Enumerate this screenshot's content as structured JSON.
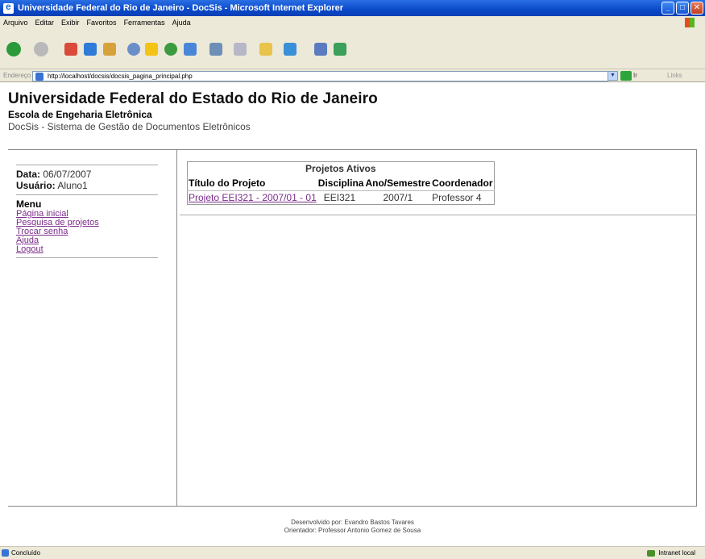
{
  "window": {
    "title": "Universidade Federal do Rio de Janeiro - DocSis - Microsoft Internet Explorer",
    "menu": [
      "Arquivo",
      "Editar",
      "Exibir",
      "Favoritos",
      "Ferramentas",
      "Ajuda"
    ],
    "address_label": "Endereço",
    "url": "http://localhost/docsis/docsis_pagina_principal.php",
    "go_label": "Ir",
    "links_label": "Links",
    "status": "Concluído",
    "zone": "Intranet local"
  },
  "header": {
    "university": "Universidade Federal do Estado do Rio de Janeiro",
    "school": "Escola de Engeharia Eletrônica",
    "system": "DocSis - Sistema de Gestão de Documentos Eletrônicos"
  },
  "sidebar": {
    "date_label": "Data:",
    "date_value": "06/07/2007",
    "user_label": "Usuário:",
    "user_value": "Aluno1",
    "menu_title": "Menu",
    "links": [
      "Página inicial",
      "Pesquisa de projetos",
      "Trocar senha",
      "Ajuda",
      "Logout"
    ]
  },
  "projects": {
    "title": "Projetos Ativos",
    "columns": [
      "Título do Projeto",
      "Disciplina",
      "Ano/Semestre",
      "Coordenador"
    ],
    "rows": [
      [
        "Projeto EEI321 - 2007/01 - 01",
        "EEI321",
        "2007/1",
        "Professor 4"
      ]
    ]
  },
  "footer": {
    "line1": "Desenvolvido por: Evandro Bastos Tavares",
    "line2": "Orientador: Professor Antonio Gomez de Sousa"
  },
  "colors": {
    "link_visited": "#7a2c8a",
    "title_bar": "#0a49c9"
  }
}
